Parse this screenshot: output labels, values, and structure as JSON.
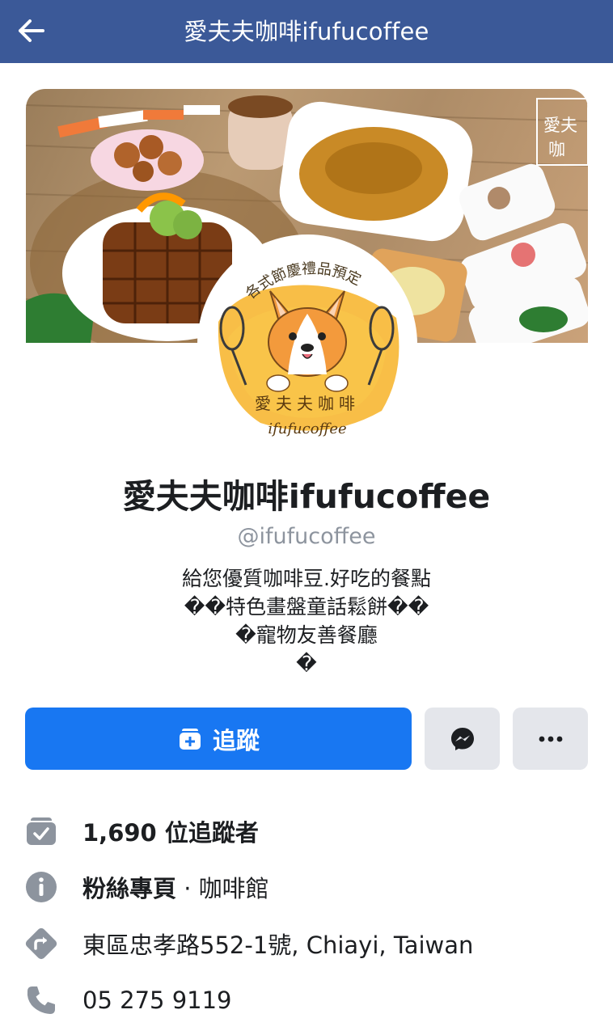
{
  "header": {
    "title": "愛夫夫咖啡ifufucoffee",
    "back_icon": "arrow-left-icon",
    "background": "#3b5998"
  },
  "cover": {
    "label": "cover-photo",
    "logo_lines": [
      "愛夫",
      "咖"
    ]
  },
  "avatar": {
    "banner_text": "各式節慶禮品預定",
    "name_cn": "愛夫夫咖啡",
    "name_en": "ifufucoffee"
  },
  "profile": {
    "name": "愛夫夫咖啡ifufucoffee",
    "handle": "@ifufucoffee",
    "bio_lines": [
      "給您優質咖啡豆.好吃的餐點",
      "��特色畫盤童話鬆餅��",
      "�寵物友善餐廳",
      "�"
    ]
  },
  "actions": {
    "follow_label": "追蹤",
    "follow_color": "#1877f2",
    "messenger_icon": "messenger-icon",
    "more_icon": "more-horizontal-icon"
  },
  "info": {
    "followers_count": "1,690",
    "followers_suffix": " 位追蹤者",
    "page_type": "粉絲專頁",
    "separator": " · ",
    "category": "咖啡館",
    "address": "東區忠孝路552-1號, Chiayi, Taiwan",
    "phone": "05 275 9119"
  }
}
